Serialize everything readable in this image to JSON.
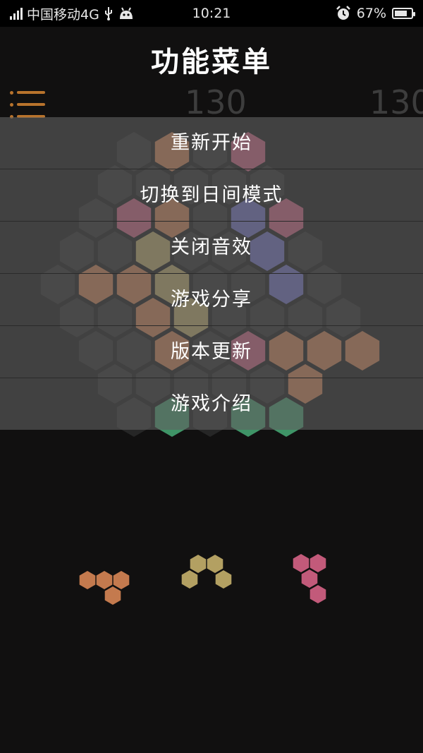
{
  "status_bar": {
    "carrier": "中国移动4G",
    "time": "10:21",
    "battery": "67%",
    "battery_level": 0.67
  },
  "title": "功能菜单",
  "scores": {
    "current": "130",
    "best": "130"
  },
  "menu": {
    "items": [
      {
        "label": "重新开始"
      },
      {
        "label": "切换到日间模式"
      },
      {
        "label": "关闭音效"
      },
      {
        "label": "游戏分享"
      },
      {
        "label": "版本更新"
      },
      {
        "label": "游戏介绍"
      }
    ]
  },
  "colors": {
    "orange": "#c47a4e",
    "pink": "#c25a7a",
    "olive": "#b3a062",
    "purple": "#6667b8",
    "green": "#3f9467",
    "empty": "#262626",
    "accent": "#b8732c"
  },
  "icons": [
    "menu-icon",
    "signal-icon",
    "usb-icon",
    "android-icon",
    "alarm-icon",
    "battery-icon"
  ]
}
